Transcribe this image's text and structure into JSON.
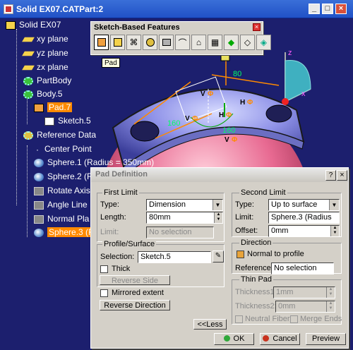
{
  "window": {
    "title": "Solid EX07.CATPart:2"
  },
  "tree": {
    "root": "Solid EX07",
    "items": [
      {
        "label": "xy plane"
      },
      {
        "label": "yz plane"
      },
      {
        "label": "zx plane"
      },
      {
        "label": "PartBody"
      },
      {
        "label": "Body.5"
      },
      {
        "label": "Pad.7"
      },
      {
        "label": "Sketch.5"
      },
      {
        "label": "Reference Data"
      },
      {
        "label": "Center Point"
      },
      {
        "label": "Sphere.1 (Radius = 350mm)"
      },
      {
        "label": "Sphere.2 (Ra"
      },
      {
        "label": "Rotate Axis"
      },
      {
        "label": "Angle Line"
      },
      {
        "label": "Normal Pla"
      },
      {
        "label": "Sphere.3 (R"
      }
    ]
  },
  "toolbar": {
    "title": "Sketch-Based Features",
    "close": "×",
    "tooltip": "Pad"
  },
  "canvas": {
    "dim1": "160",
    "dim2": "160",
    "dim3": "80",
    "marks": [
      "V",
      "H",
      "V",
      "H",
      "V"
    ],
    "phi": [
      "Φ",
      "Φ",
      "Φ",
      "Φ",
      "Φ"
    ],
    "axis_z": "z",
    "axis_x": "x"
  },
  "dialog": {
    "title": "Pad Definition",
    "help": "?",
    "close": "×",
    "first_limit": {
      "group_title": "First Limit",
      "type_label": "Type:",
      "type_value": "Dimension",
      "length_label": "Length:",
      "length_value": "80mm",
      "limit_label": "Limit:",
      "limit_value": "No selection"
    },
    "profile": {
      "group_title": "Profile/Surface",
      "selection_label": "Selection:",
      "selection_value": "Sketch.5",
      "thick_label": "Thick",
      "reverse_side": "Reverse Side"
    },
    "mirrored_extent": "Mirrored extent",
    "reverse_direction": "Reverse Direction",
    "less": "<<Less",
    "second_limit": {
      "group_title": "Second Limit",
      "type_label": "Type:",
      "type_value": "Up to surface",
      "limit_label": "Limit:",
      "limit_value": "Sphere.3 (Radius",
      "offset_label": "Offset:",
      "offset_value": "0mm"
    },
    "direction": {
      "group_title": "Direction",
      "normal_label": "Normal to profile",
      "reference_label": "Reference:",
      "reference_value": "No selection"
    },
    "thin_pad": {
      "group_title": "Thin Pad",
      "thickness1_label": "Thickness1:",
      "thickness1_value": "1mm",
      "thickness2_label": "Thickness2:",
      "thickness2_value": "0mm",
      "neutral_fiber": "Neutral Fiber",
      "merge_ends": "Merge Ends"
    },
    "ok": "OK",
    "cancel": "Cancel",
    "preview": "Preview"
  }
}
